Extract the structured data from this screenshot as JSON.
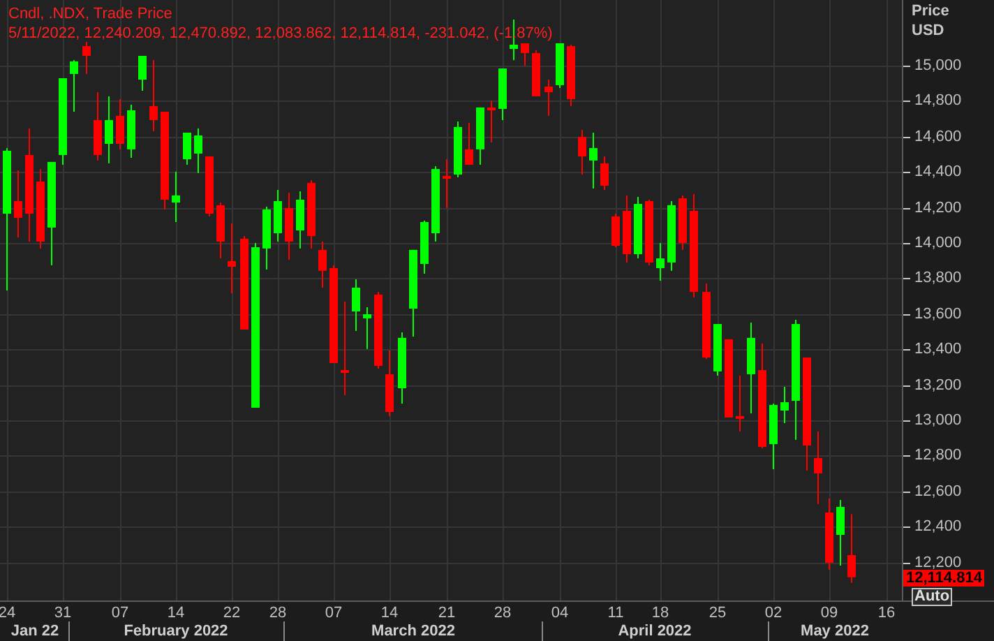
{
  "legend": {
    "title": "Cndl, .NDX, Trade Price",
    "values": "5/11/2022, 12,240.209, 12,470.892, 12,083.862, 12,114.814, -231.042, (-1.87%)"
  },
  "axis_header": [
    "Price",
    "USD"
  ],
  "last_price": {
    "label": "12,114.814"
  },
  "scale_button": {
    "label": "Auto"
  },
  "months": [
    {
      "label": "Jan 22"
    },
    {
      "label": "February 2022"
    },
    {
      "label": "March 2022"
    },
    {
      "label": "April 2022"
    },
    {
      "label": "May 2022"
    }
  ],
  "chart_data": {
    "type": "candlestick",
    "grid": true,
    "ylim": [
      11984,
      15370
    ],
    "categories": [
      "24",
      null,
      null,
      null,
      null,
      "31",
      null,
      null,
      null,
      null,
      "07",
      null,
      null,
      null,
      null,
      "14",
      null,
      null,
      null,
      null,
      "22",
      null,
      null,
      null,
      "28",
      null,
      null,
      null,
      null,
      "07",
      null,
      null,
      null,
      null,
      "14",
      null,
      null,
      null,
      null,
      "21",
      null,
      null,
      null,
      null,
      "28",
      null,
      null,
      null,
      null,
      "04",
      null,
      null,
      null,
      null,
      "11",
      null,
      null,
      null,
      "18",
      null,
      null,
      null,
      null,
      "25",
      null,
      null,
      null,
      null,
      "02",
      null,
      null,
      null,
      null,
      "09",
      null,
      null,
      null,
      null,
      "16"
    ],
    "ohlc": [
      [
        14165,
        14535,
        13732,
        14520
      ],
      [
        14236,
        14409,
        14031,
        14142
      ],
      [
        14496,
        14646,
        14008,
        14165
      ],
      [
        14346,
        14417,
        13969,
        14008
      ],
      [
        14087,
        14457,
        13874,
        14457
      ],
      [
        14496,
        14929,
        14441,
        14929
      ],
      [
        14953,
        15031,
        14740,
        15024
      ],
      [
        15110,
        15134,
        14953,
        15055
      ],
      [
        14693,
        14850,
        14465,
        14496
      ],
      [
        14559,
        14827,
        14449,
        14693
      ],
      [
        14717,
        14811,
        14528,
        14559
      ],
      [
        14528,
        14780,
        14480,
        14748
      ],
      [
        14921,
        15055,
        14858,
        15055
      ],
      [
        14772,
        15031,
        14630,
        14693
      ],
      [
        14740,
        14740,
        14189,
        14244
      ],
      [
        14228,
        14402,
        14118,
        14268
      ],
      [
        14472,
        14622,
        14441,
        14622
      ],
      [
        14504,
        14646,
        14394,
        14606
      ],
      [
        14488,
        14488,
        14150,
        14165
      ],
      [
        14213,
        14228,
        13913,
        14008
      ],
      [
        13898,
        14110,
        13717,
        13866
      ],
      [
        14024,
        14039,
        13512,
        13512
      ],
      [
        13071,
        14000,
        13071,
        13976
      ],
      [
        13969,
        14205,
        13850,
        14189
      ],
      [
        14055,
        14299,
        14008,
        14236
      ],
      [
        14197,
        14283,
        13906,
        14008
      ],
      [
        14071,
        14291,
        13969,
        14244
      ],
      [
        14339,
        14354,
        13969,
        14039
      ],
      [
        13961,
        14008,
        13748,
        13843
      ],
      [
        13858,
        13874,
        13323,
        13323
      ],
      [
        13283,
        13669,
        13142,
        13268
      ],
      [
        13614,
        13795,
        13504,
        13748
      ],
      [
        13575,
        13638,
        13402,
        13598
      ],
      [
        13709,
        13724,
        13291,
        13307
      ],
      [
        13260,
        13394,
        13024,
        13047
      ],
      [
        13181,
        13496,
        13094,
        13465
      ],
      [
        13630,
        13961,
        13472,
        13961
      ],
      [
        13882,
        14126,
        13827,
        14118
      ],
      [
        14055,
        14433,
        14008,
        14417
      ],
      [
        14378,
        14472,
        14197,
        14370
      ],
      [
        14386,
        14685,
        14370,
        14654
      ],
      [
        14528,
        14677,
        14441,
        14441
      ],
      [
        14528,
        14764,
        14441,
        14764
      ],
      [
        14764,
        14803,
        14567,
        14748
      ],
      [
        14756,
        14984,
        14693,
        14984
      ],
      [
        15094,
        15260,
        15031,
        15118
      ],
      [
        15126,
        15126,
        15000,
        15071
      ],
      [
        15071,
        15087,
        14827,
        14827
      ],
      [
        14882,
        14921,
        14717,
        14850
      ],
      [
        14890,
        15126,
        14874,
        15126
      ],
      [
        15110,
        15118,
        14772,
        14811
      ],
      [
        14598,
        14638,
        14386,
        14488
      ],
      [
        14465,
        14622,
        14307,
        14535
      ],
      [
        14449,
        14488,
        14299,
        14323
      ],
      [
        14150,
        14165,
        13976,
        13984
      ],
      [
        14181,
        14268,
        13890,
        13937
      ],
      [
        13937,
        14260,
        13913,
        14220
      ],
      [
        14236,
        14244,
        13874,
        13890
      ],
      [
        13858,
        14000,
        13787,
        13913
      ],
      [
        13890,
        14236,
        13843,
        14213
      ],
      [
        14252,
        14268,
        13961,
        14000
      ],
      [
        14181,
        14276,
        13693,
        13724
      ],
      [
        13724,
        13772,
        13346,
        13354
      ],
      [
        13276,
        13543,
        13252,
        13543
      ],
      [
        13457,
        13457,
        13016,
        13016
      ],
      [
        13024,
        13252,
        12937,
        13016
      ],
      [
        13260,
        13551,
        13039,
        13465
      ],
      [
        13283,
        13433,
        12842,
        12850
      ],
      [
        12866,
        13094,
        12724,
        13087
      ],
      [
        13055,
        13189,
        12984,
        13102
      ],
      [
        13110,
        13567,
        12890,
        13543
      ],
      [
        13354,
        13354,
        12717,
        12858
      ],
      [
        12787,
        12937,
        12528,
        12701
      ],
      [
        12480,
        12559,
        12157,
        12197
      ],
      [
        12354,
        12551,
        12181,
        12512
      ],
      [
        12240,
        12471,
        12084,
        12115
      ],
      null,
      null,
      null
    ],
    "yticks": [
      {
        "value": 15000,
        "label": "15,000"
      },
      {
        "value": 14800,
        "label": "14,800"
      },
      {
        "value": 14600,
        "label": "14,600"
      },
      {
        "value": 14400,
        "label": "14,400"
      },
      {
        "value": 14200,
        "label": "14,200"
      },
      {
        "value": 14000,
        "label": "14,000"
      },
      {
        "value": 13800,
        "label": "13,800"
      },
      {
        "value": 13600,
        "label": "13,600"
      },
      {
        "value": 13400,
        "label": "13,400"
      },
      {
        "value": 13200,
        "label": "13,200"
      },
      {
        "value": 13000,
        "label": "13,000"
      },
      {
        "value": 12800,
        "label": "12,800"
      },
      {
        "value": 12600,
        "label": "12,600"
      },
      {
        "value": 12400,
        "label": "12,400"
      },
      {
        "value": 12200,
        "label": "12,200"
      }
    ]
  }
}
